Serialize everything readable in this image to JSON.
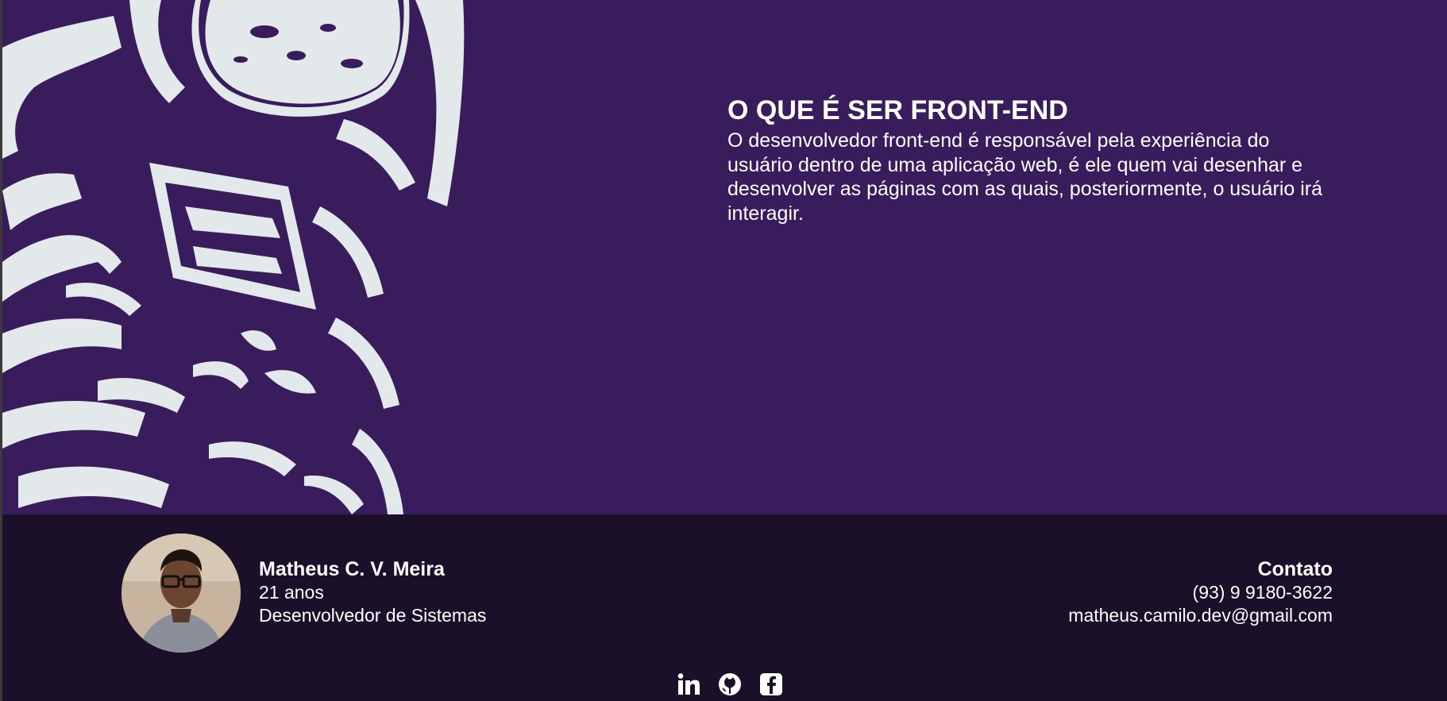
{
  "section": {
    "title": "O QUE É SER FRONT-END",
    "paragraph": "O desenvolvedor front-end é responsável pela experiência do usuário dentro de uma aplicação web, é ele quem vai desenhar e desenvolver as páginas com as quais, posteriormente, o usuário irá interagir."
  },
  "footer": {
    "profile": {
      "name": "Matheus C. V. Meira",
      "age": "21 anos",
      "role": "Desenvolvedor de Sistemas"
    },
    "contact": {
      "title": "Contato",
      "phone": "(93) 9 9180-3622",
      "email": "matheus.camilo.dev@gmail.com"
    },
    "socials": [
      {
        "icon": "linkedin-icon"
      },
      {
        "icon": "github-icon"
      },
      {
        "icon": "facebook-icon"
      }
    ]
  },
  "colors": {
    "hero_bg": "#381c5b",
    "footer_bg": "#1a1029",
    "illustration": "#e3e8ea",
    "text": "#ffffff"
  }
}
